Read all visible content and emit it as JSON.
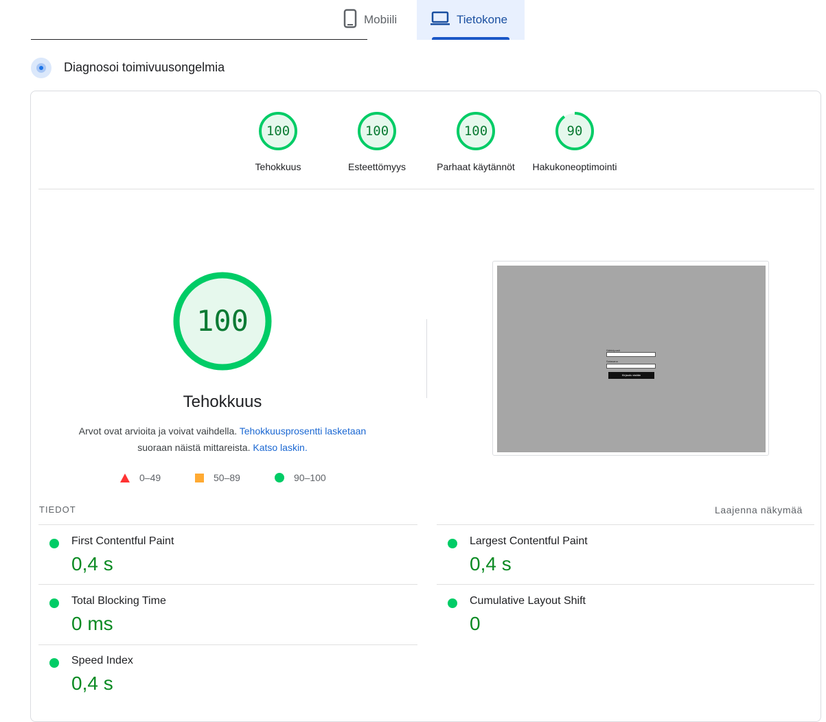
{
  "tabs": [
    {
      "label": "Mobiili",
      "icon": "phone-icon",
      "selected": false
    },
    {
      "label": "Tietokone",
      "icon": "laptop-icon",
      "selected": true
    }
  ],
  "diagnose": {
    "title": "Diagnosoi toimivuusongelmia",
    "icon": "diagnose-icon"
  },
  "scores": [
    {
      "score": "100",
      "label": "Tehokkuus",
      "fraction": 1.0
    },
    {
      "score": "100",
      "label": "Esteettömyys",
      "fraction": 1.0
    },
    {
      "score": "100",
      "label": "Parhaat käytännöt",
      "fraction": 1.0
    },
    {
      "score": "90",
      "label": "Hakukoneoptimointi",
      "fraction": 0.9
    }
  ],
  "performance": {
    "score": "100",
    "fraction": 1.0,
    "title": "Tehokkuus",
    "desc_part1": "Arvot ovat arvioita ja voivat vaihdella.",
    "desc_link1": "Tehokkuusprosentti lasketaan",
    "desc_part2": "suoraan näistä mittareista.",
    "desc_link2": "Katso laskin."
  },
  "legend": [
    {
      "range": "0–49",
      "shape": "triangle",
      "color": "#ff3333"
    },
    {
      "range": "50–89",
      "shape": "square",
      "color": "#ffaa33"
    },
    {
      "range": "90–100",
      "shape": "circle",
      "color": "#00cc66"
    }
  ],
  "metrics_header": {
    "label": "TIEDOT",
    "expand": "Laajenna näkymää"
  },
  "metrics": [
    {
      "name": "First Contentful Paint",
      "value": "0,4 s"
    },
    {
      "name": "Largest Contentful Paint",
      "value": "0,4 s"
    },
    {
      "name": "Total Blocking Time",
      "value": "0 ms"
    },
    {
      "name": "Cumulative Layout Shift",
      "value": "0"
    },
    {
      "name": "Speed Index",
      "value": "0,4 s"
    }
  ],
  "screenshot": {
    "field1_label": "Sähköposti",
    "field2_label": "Salasana",
    "button_label": "Kirjaudu sisään"
  },
  "colors": {
    "pass": "#0c6",
    "pass_text": "#0a8a22",
    "accent": "#1a57c7"
  }
}
